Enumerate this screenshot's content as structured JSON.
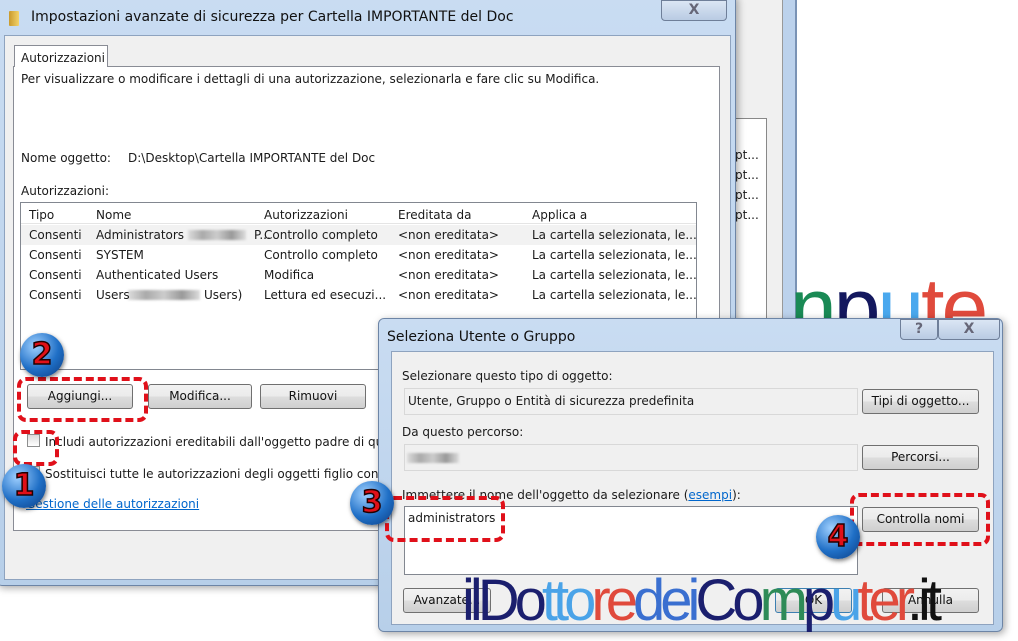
{
  "background_window": {
    "rows": [
      "pt...",
      "pt...",
      "pt...",
      "pt..."
    ]
  },
  "main_dialog": {
    "title": "Impostazioni avanzate di sicurezza per Cartella IMPORTANTE del Doc",
    "close_label": "X",
    "tab": "Autorizzazioni",
    "description": "Per visualizzare o modificare i dettagli di una autorizzazione, selezionarla e fare clic su Modifica.",
    "object_name_label": "Nome oggetto:",
    "object_name_value": "D:\\Desktop\\Cartella IMPORTANTE del Doc",
    "permissions_label": "Autorizzazioni:",
    "columns": [
      "Tipo",
      "Nome",
      "Autorizzazioni",
      "Ereditata da",
      "Applica a"
    ],
    "rows": [
      {
        "tipo": "Consenti",
        "nome": "Administrators",
        "nome_suffix": "P...",
        "aut": "Controllo completo",
        "ered": "<non ereditata>",
        "applica": "La cartella selezionata, le..."
      },
      {
        "tipo": "Consenti",
        "nome": "SYSTEM",
        "nome_suffix": "",
        "aut": "Controllo completo",
        "ered": "<non ereditata>",
        "applica": "La cartella selezionata, le..."
      },
      {
        "tipo": "Consenti",
        "nome": "Authenticated Users",
        "nome_suffix": "",
        "aut": "Modifica",
        "ered": "<non ereditata>",
        "applica": "La cartella selezionata, le..."
      },
      {
        "tipo": "Consenti",
        "nome": "Users",
        "nome_suffix": "Users)",
        "aut": "Lettura ed esecuzi...",
        "ered": "<non ereditata>",
        "applica": "La cartella selezionata, le..."
      }
    ],
    "buttons": {
      "add": "Aggiungi...",
      "edit": "Modifica...",
      "remove": "Rimuovi"
    },
    "checkbox_inherit": {
      "label": "Includi autorizzazioni ereditabili dall'oggetto padre di ques",
      "checked": false
    },
    "checkbox_replace": {
      "label": "Sostituisci tutte le autorizzazioni degli oggetti figlio con au",
      "checked": false
    },
    "link": "Gestione delle autorizzazioni"
  },
  "select_dialog": {
    "title": "Seleziona Utente o Gruppo",
    "help_label": "?",
    "close_label": "X",
    "object_type_label": "Selezionare questo tipo di oggetto:",
    "object_type_value": "Utente, Gruppo o Entità di sicurezza predefinita",
    "object_type_button": "Tipi di oggetto...",
    "location_label": "Da questo percorso:",
    "location_button": "Percorsi...",
    "enter_name_label": "Immettere il nome dell'oggetto da selezionare (",
    "examples_link": "esempi",
    "enter_name_label_end": "):",
    "name_value": "administrators",
    "check_names_button": "Controlla nomi",
    "advanced_button": "Avanzate...",
    "ok_button": "OK",
    "cancel_button": "Annulla"
  },
  "annotations": [
    "1",
    "2",
    "3",
    "4"
  ],
  "annotation_color": "#e0101a",
  "watermark": "ilDottoredeiComputer.it",
  "watermark_partial": "npute"
}
